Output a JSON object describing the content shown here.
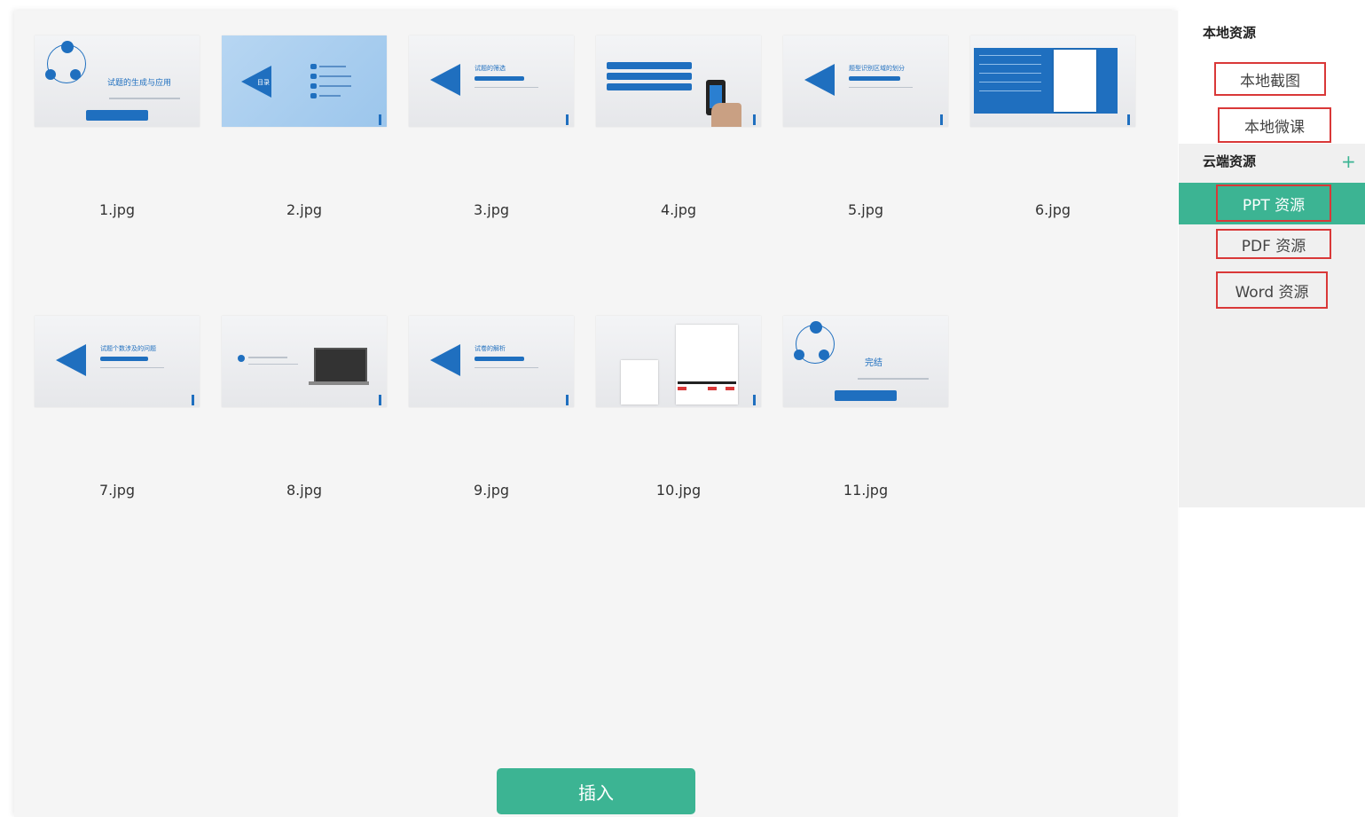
{
  "sidebar": {
    "local_title": "本地资源",
    "local_items": [
      {
        "label": "本地截图"
      },
      {
        "label": "本地微课"
      }
    ],
    "cloud_title": "云端资源",
    "cloud_items": [
      {
        "label": "PPT 资源",
        "active": true
      },
      {
        "label": "PDF 资源"
      },
      {
        "label": "Word 资源"
      }
    ],
    "add_icon": "plus-icon"
  },
  "thumbnails": [
    {
      "filename": "1.jpg",
      "slide_text": "试题的生成与应用"
    },
    {
      "filename": "2.jpg",
      "slide_text": "目录"
    },
    {
      "filename": "3.jpg",
      "slide_text": "试题的筛选"
    },
    {
      "filename": "4.jpg",
      "slide_text": ""
    },
    {
      "filename": "5.jpg",
      "slide_text": "题型识别区域的划分"
    },
    {
      "filename": "6.jpg",
      "slide_text": ""
    },
    {
      "filename": "7.jpg",
      "slide_text": "试题个数涉及的问题"
    },
    {
      "filename": "8.jpg",
      "slide_text": ""
    },
    {
      "filename": "9.jpg",
      "slide_text": "试卷的解析"
    },
    {
      "filename": "10.jpg",
      "slide_text": ""
    },
    {
      "filename": "11.jpg",
      "slide_text": "完结"
    }
  ],
  "insert_button": {
    "label": "插入"
  },
  "colors": {
    "accent": "#3cb493",
    "slide_blue": "#1f6fbf",
    "highlight_border": "#d93838"
  }
}
